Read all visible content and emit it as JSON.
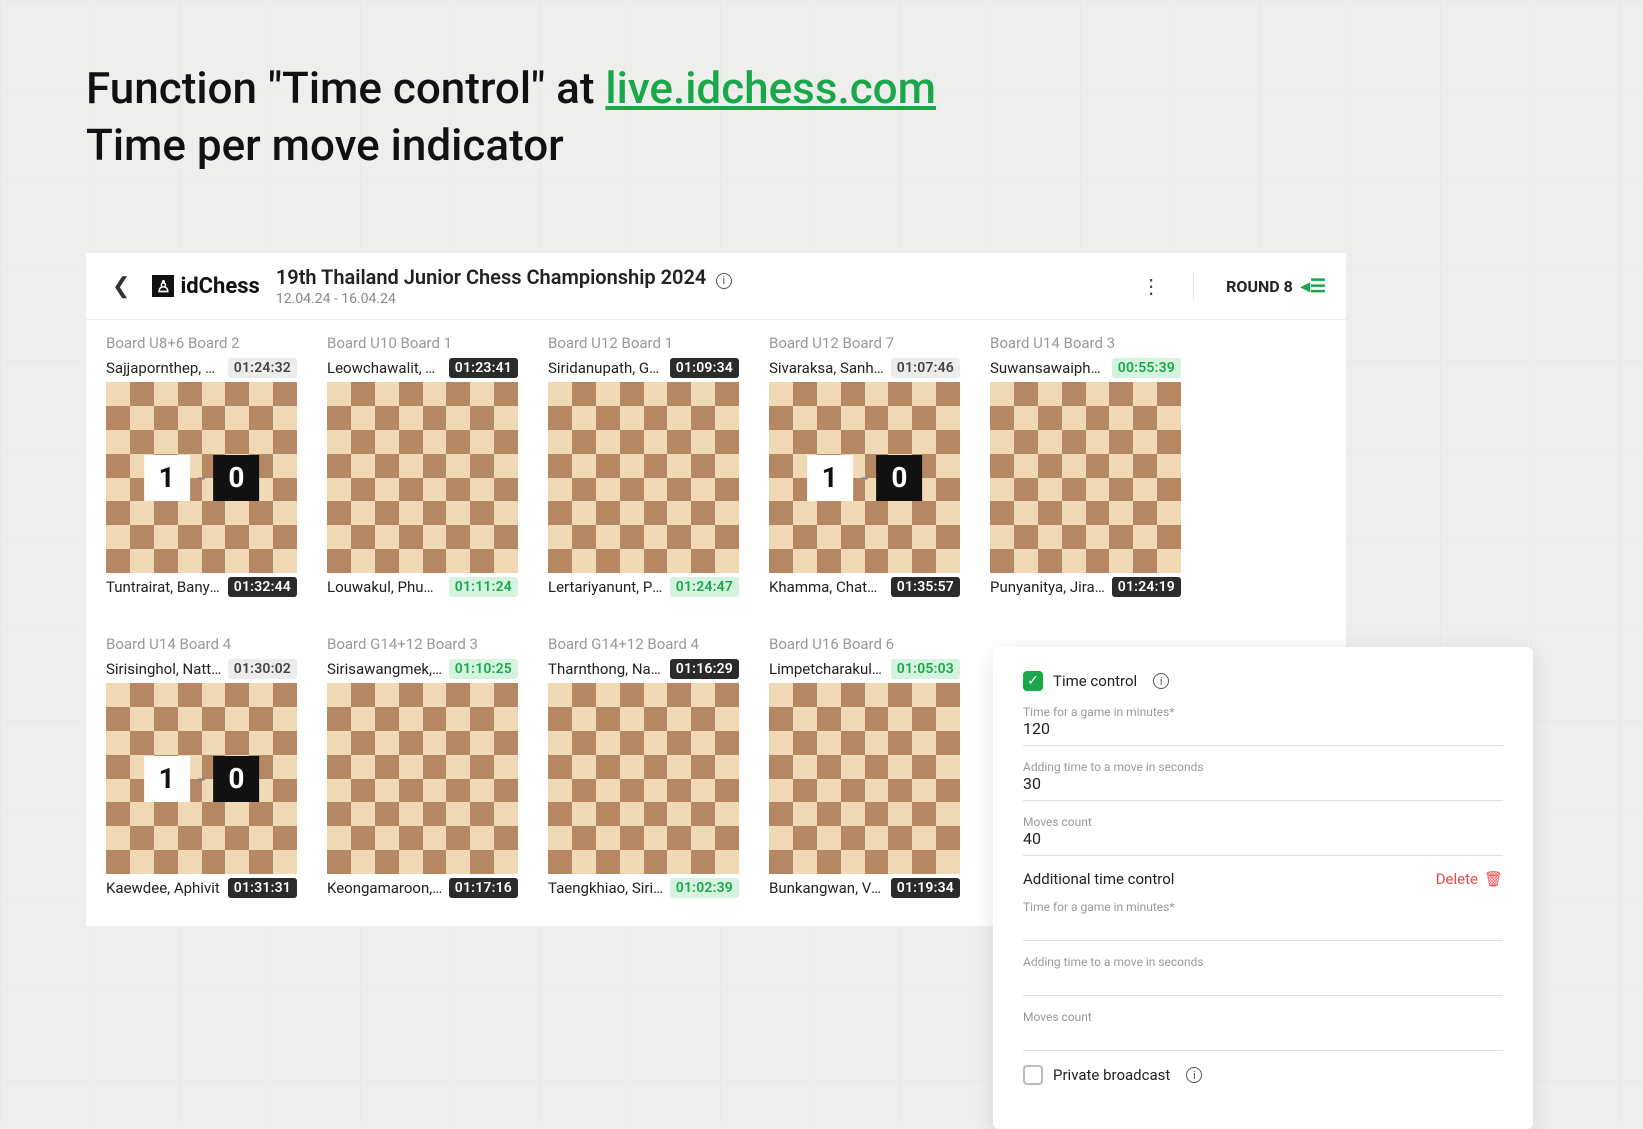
{
  "title": {
    "line1_prefix": "Function \"Time control\" at ",
    "link_text": "live.idchess.com",
    "line2": "Time per move indicator"
  },
  "header": {
    "logo_text": "idChess",
    "tournament": "19th Thailand Junior Chess Championship 2024",
    "dates": "12.04.24 - 16.04.24",
    "round_label": "ROUND 8"
  },
  "boards": [
    {
      "name": "Board U8+6 Board 2",
      "top": {
        "player": "Sajjapornthep, Jar…",
        "clock": "01:24:32",
        "style": "light"
      },
      "bot": {
        "player": "Tuntrairat, Banyawat",
        "clock": "01:32:44",
        "style": "dark"
      },
      "score": [
        "1",
        "0"
      ]
    },
    {
      "name": "Board U10 Board 1",
      "top": {
        "player": "Leowchawalit, Tan…",
        "clock": "01:23:41",
        "style": "dark"
      },
      "bot": {
        "player": "Louwakul, Phuwin",
        "clock": "01:11:24",
        "style": "green"
      }
    },
    {
      "name": "Board U12 Board 1",
      "top": {
        "player": "Siridanupath, Gavin",
        "clock": "01:09:34",
        "style": "dark"
      },
      "bot": {
        "player": "Lertariyanunt, Peer…",
        "clock": "01:24:47",
        "style": "green"
      }
    },
    {
      "name": "Board U12 Board 7",
      "top": {
        "player": "Sivaraksa, Sanhawat",
        "clock": "01:07:46",
        "style": "light"
      },
      "bot": {
        "player": "Khamma, Chatbhisit",
        "clock": "01:35:57",
        "style": "dark"
      },
      "score": [
        "1",
        "0"
      ]
    },
    {
      "name": "Board U14 Board 3",
      "top": {
        "player": "Suwansawaiphol, …",
        "clock": "00:55:39",
        "style": "green"
      },
      "bot": {
        "player": "Punyanitya, Jirath",
        "clock": "01:24:19",
        "style": "dark"
      }
    },
    {
      "name": "Board U14 Board 4",
      "top": {
        "player": "Sirisinghol, Nattha…",
        "clock": "01:30:02",
        "style": "light"
      },
      "bot": {
        "player": "Kaewdee, Aphivit",
        "clock": "01:31:31",
        "style": "dark"
      },
      "score": [
        "1",
        "0"
      ]
    },
    {
      "name": "Board G14+12 Board 3",
      "top": {
        "player": "Sirisawangmek, Na…",
        "clock": "01:10:25",
        "style": "green"
      },
      "bot": {
        "player": "Keongamaroon, Ar…",
        "clock": "01:17:16",
        "style": "dark"
      }
    },
    {
      "name": "Board G14+12 Board 4",
      "top": {
        "player": "Tharnthong, Nanna…",
        "clock": "01:16:29",
        "style": "dark"
      },
      "bot": {
        "player": "Taengkhiao, Sirimon",
        "clock": "01:02:39",
        "style": "green"
      }
    },
    {
      "name": "Board U16 Board 6",
      "top": {
        "player": "Limpetcharakul, N…",
        "clock": "01:05:03",
        "style": "green"
      },
      "bot": {
        "player": "Bunkangwan, Veer…",
        "clock": "01:19:34",
        "style": "dark"
      }
    }
  ],
  "panel": {
    "time_control_label": "Time control",
    "time_control_checked": true,
    "fields1": [
      {
        "label": "Time for a game in minutes*",
        "value": "120"
      },
      {
        "label": "Adding time to a move in seconds",
        "value": "30"
      },
      {
        "label": "Moves count",
        "value": "40"
      }
    ],
    "additional_label": "Additional time control",
    "delete_label": "Delete",
    "fields2": [
      {
        "label": "Time for a game in minutes*",
        "value": ""
      },
      {
        "label": "Adding time to a move in seconds",
        "value": ""
      },
      {
        "label": "Moves count",
        "value": ""
      }
    ],
    "private_label": "Private broadcast",
    "private_checked": false
  }
}
